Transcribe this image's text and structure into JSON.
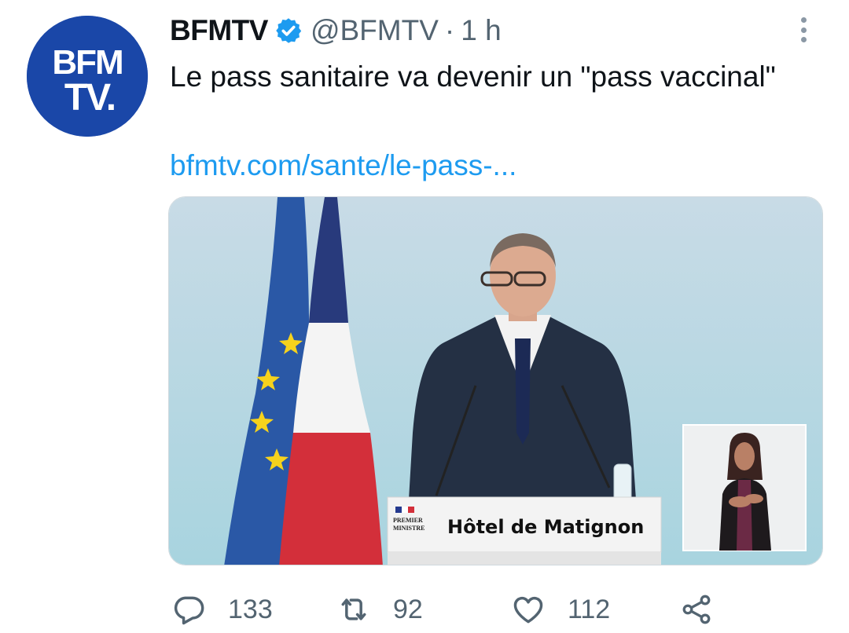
{
  "tweet": {
    "author_name": "BFMTV",
    "handle": "@BFMTV",
    "separator": "·",
    "time": "1 h",
    "text": "Le pass sanitaire va devenir un \"pass vaccinal\"",
    "link": "bfmtv.com/sante/le-pass-...",
    "avatar_text_line1": "BFM",
    "avatar_text_line2": "TV.",
    "media": {
      "podium_label": "Hôtel de Matignon",
      "podium_logo_line1": "PREMIER",
      "podium_logo_line2": "MINISTRE"
    },
    "actions": {
      "reply_icon": "reply-icon",
      "reply_count": "133",
      "retweet_icon": "retweet-icon",
      "retweet_count": "92",
      "like_icon": "heart-icon",
      "like_count": "112",
      "share_icon": "share-icon"
    }
  },
  "colors": {
    "link": "#1d9bf0",
    "avatar_bg": "#1a47a8",
    "verified": "#1d9bf0",
    "muted": "#536471"
  }
}
